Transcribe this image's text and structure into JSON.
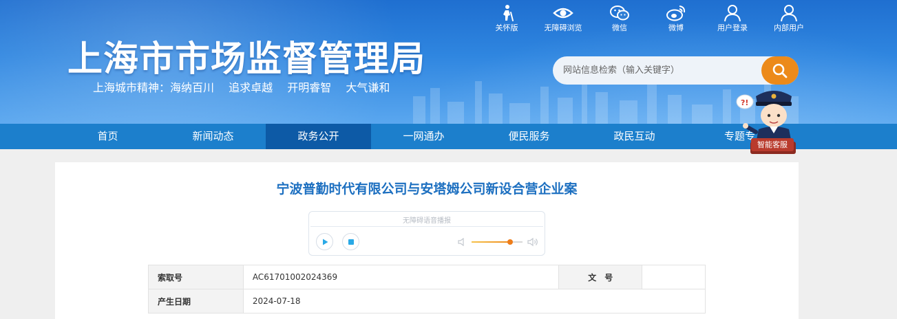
{
  "header": {
    "site_title": "上海市市场监督管理局",
    "motto": [
      "上海城市精神：海纳百川",
      "追求卓越",
      "开明睿智",
      "大气谦和"
    ]
  },
  "toolbar": [
    {
      "label": "关怀版",
      "icon": "elderly-care-icon"
    },
    {
      "label": "无障碍浏览",
      "icon": "eye-icon"
    },
    {
      "label": "微信",
      "icon": "wechat-icon"
    },
    {
      "label": "微博",
      "icon": "weibo-icon"
    },
    {
      "label": "用户登录",
      "icon": "user-icon"
    },
    {
      "label": "内部用户",
      "icon": "user-icon"
    }
  ],
  "search": {
    "placeholder": "网站信息检索（输入关键字）"
  },
  "nav": {
    "items": [
      "首页",
      "新闻动态",
      "政务公开",
      "一网通办",
      "便民服务",
      "政民互动",
      "专题专"
    ],
    "active": "政务公开"
  },
  "assistant": {
    "label": "智能客服"
  },
  "article": {
    "title": "宁波普勤时代有限公司与安塔姆公司新设合营企业案"
  },
  "player": {
    "label": "无障碍语音播报",
    "volume": 0.75
  },
  "info_table": {
    "rows": [
      {
        "key": "索取号",
        "value": "AC61701002024369",
        "key2": "文　号",
        "value2": ""
      },
      {
        "key": "产生日期",
        "value": "2024-07-18"
      }
    ]
  },
  "colors": {
    "nav": "#1c7fcc",
    "nav_active": "#0d5aa6",
    "title": "#1c6fc0",
    "search_button": "#ec8a1a"
  }
}
